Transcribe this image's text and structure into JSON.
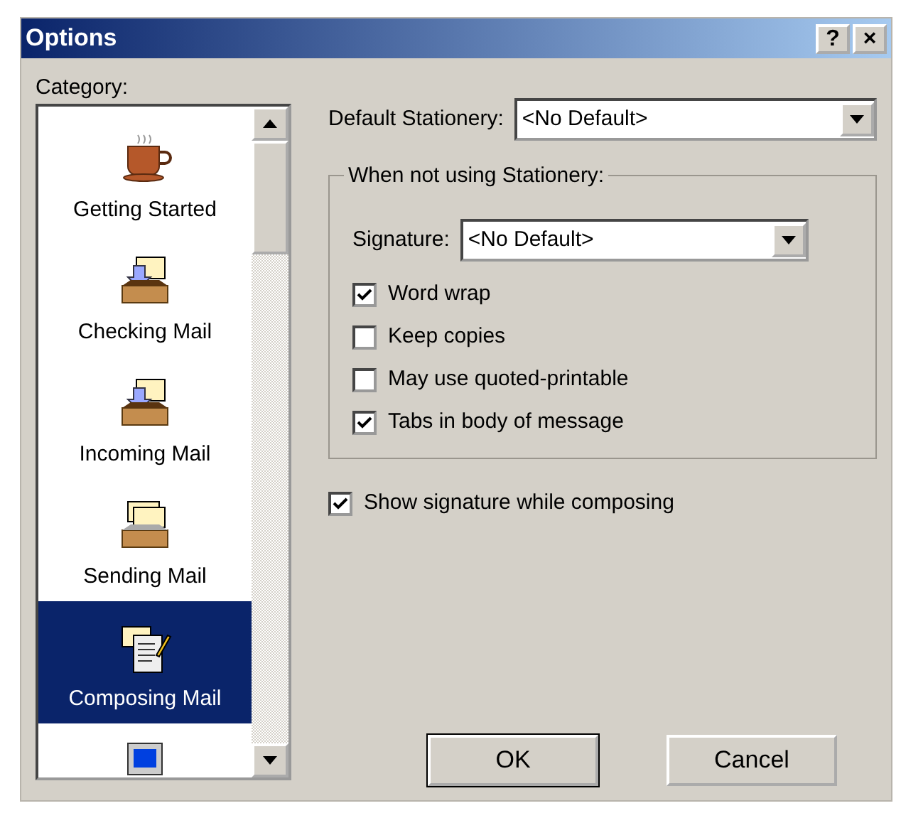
{
  "window": {
    "title": "Options",
    "help_button": "?",
    "close_button": "×"
  },
  "category": {
    "label": "Category:",
    "items": [
      {
        "kind": "cup",
        "label": "Getting Started",
        "selected": false
      },
      {
        "kind": "inbox",
        "label": "Checking Mail",
        "selected": false
      },
      {
        "kind": "inbox",
        "label": "Incoming Mail",
        "selected": false
      },
      {
        "kind": "outbox",
        "label": "Sending Mail",
        "selected": false
      },
      {
        "kind": "compose",
        "label": "Composing Mail",
        "selected": true
      },
      {
        "kind": "computer",
        "selected": false
      }
    ]
  },
  "default_stationery": {
    "label": "Default Stationery:",
    "value": "<No Default>"
  },
  "group": {
    "title": "When not using Stationery:",
    "signature": {
      "label": "Signature:",
      "value": "<No Default>"
    },
    "options": [
      {
        "label": "Word wrap",
        "checked": true
      },
      {
        "label": "Keep copies",
        "checked": false
      },
      {
        "label": "May use quoted-printable",
        "checked": false
      },
      {
        "label": "Tabs in body of message",
        "checked": true
      }
    ]
  },
  "show_signature": {
    "label": "Show signature while composing",
    "checked": true
  },
  "buttons": [
    {
      "label": "OK",
      "default": true
    },
    {
      "label": "Cancel",
      "default": false
    }
  ]
}
